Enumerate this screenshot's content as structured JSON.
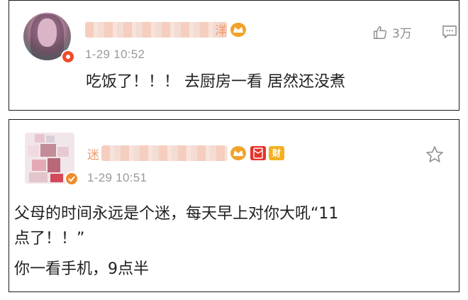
{
  "comments": [
    {
      "name_tail": "洋",
      "time": "1-29 10:52",
      "text": "吃饭了！！！ 去厨房一看 居然还没煮",
      "likes": "3万",
      "badges": [
        "crown-icon"
      ]
    },
    {
      "name_lead": "迷",
      "time": "1-29 10:51",
      "text_line1": "父母的时间永远是个迷，每天早上对你大吼“11",
      "text_line2": "点了！！”",
      "text_line3": "你一看手机，9点半",
      "badges": [
        "crown-icon",
        "red-envelope-icon",
        "wealth-icon"
      ],
      "badge_wealth_char": "财"
    }
  ],
  "colors": {
    "text": "#1f1f1f",
    "meta": "#9a9a9a",
    "accent_orange": "#f19b6e",
    "badge_red": "#e6332a"
  }
}
